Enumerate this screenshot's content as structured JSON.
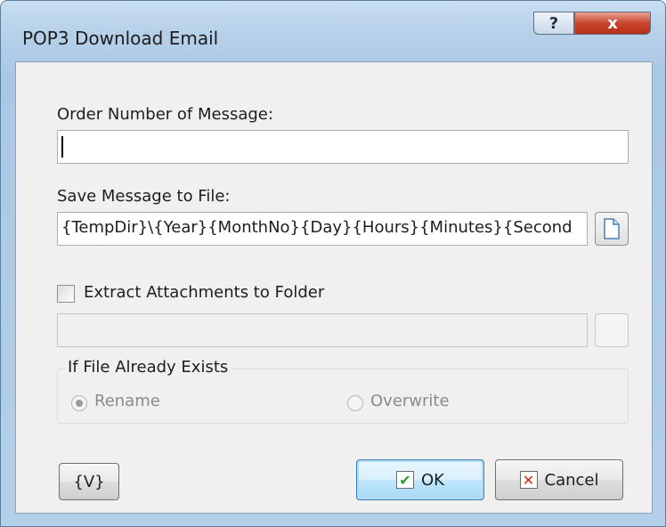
{
  "window": {
    "title": "POP3 Download Email",
    "help_label": "?",
    "close_label": "x"
  },
  "order": {
    "label": "Order Number of Message:",
    "value": ""
  },
  "save": {
    "label": "Save Message to File:",
    "value": "{TempDir}\\{Year}{MonthNo}{Day}{Hours}{Minutes}{Second",
    "browse_icon": "document-icon"
  },
  "extract": {
    "checkbox_label": "Extract Attachments to Folder",
    "checked": false,
    "value": ""
  },
  "file_exists": {
    "legend": "If File Already Exists",
    "options": [
      {
        "label": "Rename",
        "selected": true
      },
      {
        "label": "Overwrite",
        "selected": false
      }
    ]
  },
  "buttons": {
    "variables": "{V}",
    "ok": "OK",
    "cancel": "Cancel"
  },
  "icons": {
    "ok": "checkmark-icon",
    "cancel": "x-icon"
  }
}
